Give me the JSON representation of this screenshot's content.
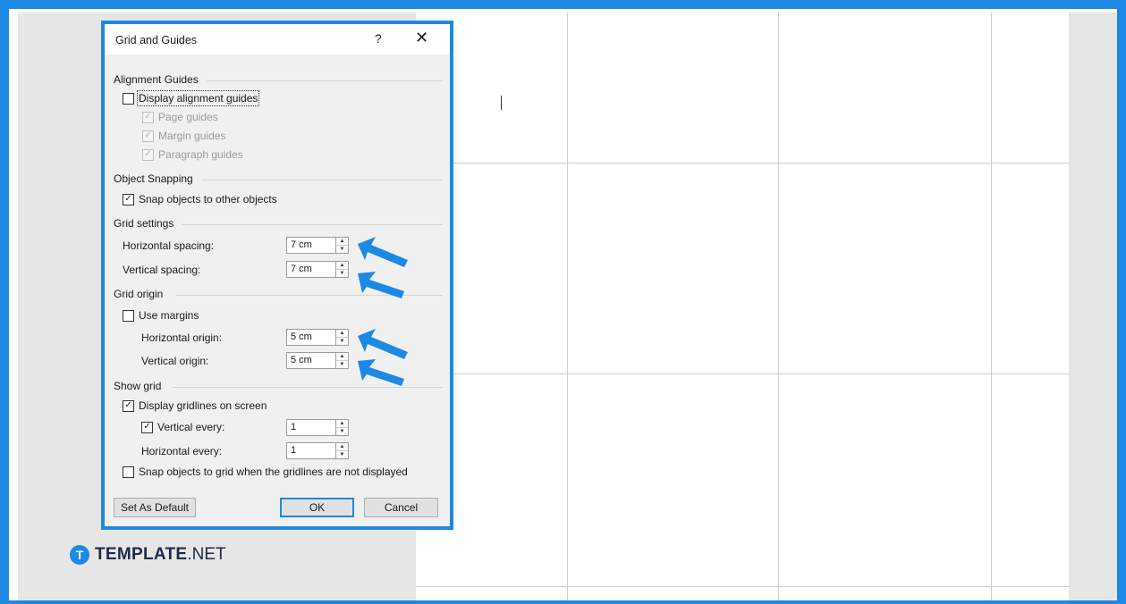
{
  "dialog": {
    "title": "Grid and Guides",
    "help_label": "?",
    "close_label": "✕",
    "alignment": {
      "heading": "Alignment Guides",
      "display_label": "Display alignment guides",
      "page_guides": "Page guides",
      "margin_guides": "Margin guides",
      "paragraph_guides": "Paragraph guides"
    },
    "snapping": {
      "heading": "Object Snapping",
      "snap_label": "Snap objects to other objects"
    },
    "grid_settings": {
      "heading": "Grid settings",
      "horizontal_label": "Horizontal spacing:",
      "horizontal_value": "7 cm",
      "vertical_label": "Vertical spacing:",
      "vertical_value": "7 cm"
    },
    "grid_origin": {
      "heading": "Grid origin",
      "use_margins_label": "Use margins",
      "horizontal_label": "Horizontal origin:",
      "horizontal_value": "5 cm",
      "vertical_label": "Vertical origin:",
      "vertical_value": "5 cm"
    },
    "show_grid": {
      "heading": "Show grid",
      "display_label": "Display gridlines on screen",
      "vertical_every_label": "Vertical every:",
      "vertical_every_value": "1",
      "horizontal_every_label": "Horizontal every:",
      "horizontal_every_value": "1",
      "snap_hidden_label": "Snap objects to grid when the gridlines are not displayed"
    },
    "buttons": {
      "set_default": "Set As Default",
      "ok": "OK",
      "cancel": "Cancel"
    }
  },
  "logo": {
    "mark": "T",
    "bold": "TEMPLATE",
    "suffix": ".NET"
  },
  "colors": {
    "accent": "#1e88e5",
    "dialog_bg": "#f0f0f0",
    "gridline": "#d0d0d0"
  },
  "icons": {
    "checkmark": "✓",
    "spin_up": "▲",
    "spin_down": "▼"
  }
}
